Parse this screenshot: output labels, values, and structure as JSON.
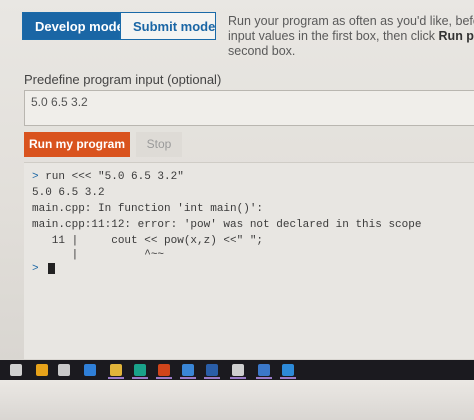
{
  "mode_tabs": {
    "develop": "Develop mode",
    "submit": "Submit mode"
  },
  "instructions": {
    "line1": "Run your program as often as you'd like, before sub",
    "line2_prefix": "input values in the first box, then click ",
    "line2_bold": "Run program",
    "line3": "second box."
  },
  "input": {
    "label": "Predefine program input (optional)",
    "value": "5.0 6.5 3.2"
  },
  "buttons": {
    "run": "Run my program",
    "stop": "Stop"
  },
  "console": {
    "lines": [
      "> run <<< \"5.0 6.5 3.2\"",
      "5.0 6.5 3.2",
      "main.cpp: In function 'int main()':",
      "main.cpp:11:12: error: 'pow' was not declared in this scope",
      "   11 |     cout << pow(x,z) <<\" \";",
      "      |",
      "                 ^~~"
    ],
    "prompt": ">"
  },
  "taskbar": {
    "icons": [
      "task-view-icon",
      "chrome-icon",
      "store-icon",
      "edge-icon",
      "files-icon",
      "app-icon",
      "office-icon",
      "mail-icon",
      "word-icon",
      "settings-icon",
      "photos-icon",
      "app2-icon"
    ],
    "colors": [
      "#d0d0d0",
      "#e6a21a",
      "#c9c9c9",
      "#2f7fd8",
      "#e1b43a",
      "#1aa38a",
      "#d0451b",
      "#3a86d6",
      "#2a5ea8",
      "#cfcfcf",
      "#3b78c9",
      "#2d8ad8"
    ]
  }
}
